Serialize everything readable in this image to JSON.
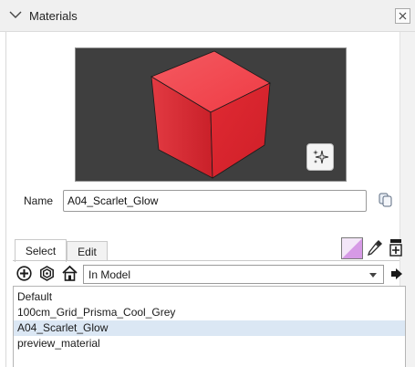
{
  "panel": {
    "title": "Materials",
    "close_glyph": "×"
  },
  "preview": {
    "background_color": "#3f3f3f",
    "material_color": "#e5303a"
  },
  "name_field": {
    "label": "Name",
    "value": "A04_Scarlet_Glow"
  },
  "tabs": [
    {
      "label": "Select",
      "active": true
    },
    {
      "label": "Edit",
      "active": false
    }
  ],
  "browser": {
    "collection": "In Model",
    "materials": [
      {
        "label": "Default",
        "selected": false
      },
      {
        "label": "100cm_Grid_Prisma_Cool_Grey",
        "selected": false
      },
      {
        "label": "A04_Scarlet_Glow",
        "selected": true
      },
      {
        "label": "preview_material",
        "selected": false
      }
    ]
  },
  "icons": {
    "panel_toggle": "chevron-down-icon",
    "close": "close-icon",
    "preview_options": "sparkle-icon",
    "duplicate": "duplicate-material-icon",
    "create": "paint-swatch-icon",
    "sample": "eyedropper-icon",
    "secondary_pane": "secondary-pane-icon",
    "add": "add-icon",
    "in_model": "in-model-icon",
    "home": "home-icon",
    "details": "details-arrow-icon"
  }
}
